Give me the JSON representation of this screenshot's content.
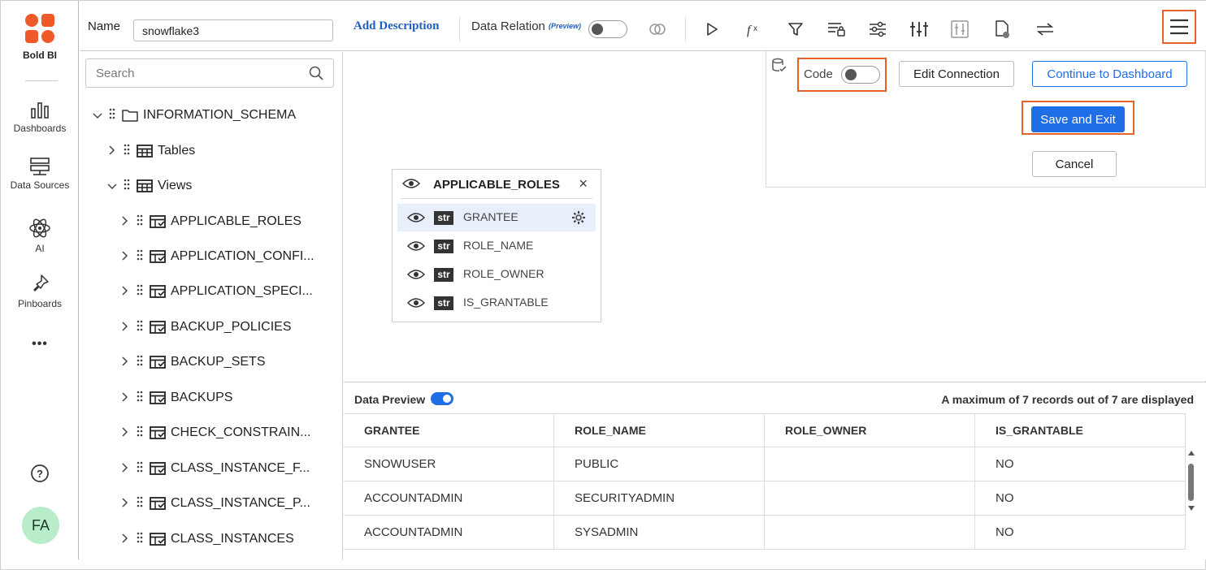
{
  "nav": {
    "brand": "Bold BI",
    "items": [
      {
        "label": "Dashboards",
        "icon": "bar-chart-icon"
      },
      {
        "label": "Data Sources",
        "icon": "server-icon"
      },
      {
        "label": "AI",
        "icon": "atom-icon"
      },
      {
        "label": "Pinboards",
        "icon": "pin-icon"
      }
    ],
    "more": "•••",
    "help": "?",
    "avatar": "FA"
  },
  "toolbar": {
    "name_label": "Name",
    "name_value": "snowflake3",
    "add_description": "Add Description",
    "data_relation": "Data Relation",
    "preview_tag": "(Preview)",
    "icons": [
      "join-icon",
      "run-icon",
      "expression-icon",
      "filter-icon",
      "parameter-icon",
      "settings-sliders-icon",
      "columns-adjust-icon",
      "column-setting-icon",
      "data-status-icon",
      "swap-icon",
      "hamburger-menu-icon"
    ]
  },
  "left_panel": {
    "search_placeholder": "Search",
    "schema": "INFORMATION_SCHEMA",
    "tables_folder": "Tables",
    "views_folder": "Views",
    "views": [
      "APPLICABLE_ROLES",
      "APPLICATION_CONFI...",
      "APPLICATION_SPECI...",
      "BACKUP_POLICIES",
      "BACKUP_SETS",
      "BACKUPS",
      "CHECK_CONSTRAIN...",
      "CLASS_INSTANCE_F...",
      "CLASS_INSTANCE_P...",
      "CLASS_INSTANCES"
    ]
  },
  "connection": {
    "code_label": "Code",
    "edit_connection": "Edit Connection",
    "continue": "Continue to Dashboard",
    "save_exit": "Save and Exit",
    "cancel": "Cancel"
  },
  "card": {
    "title": "APPLICABLE_ROLES",
    "close": "×",
    "type_badge": "str",
    "columns": [
      "GRANTEE",
      "ROLE_NAME",
      "ROLE_OWNER",
      "IS_GRANTABLE"
    ]
  },
  "preview": {
    "label": "Data Preview",
    "enabled": true,
    "info": "A maximum of 7 records out of 7 are displayed",
    "headers": [
      "GRANTEE",
      "ROLE_NAME",
      "ROLE_OWNER",
      "IS_GRANTABLE"
    ],
    "rows": [
      [
        "SNOWUSER",
        "PUBLIC",
        "",
        "NO"
      ],
      [
        "ACCOUNTADMIN",
        "SECURITYADMIN",
        "",
        "NO"
      ],
      [
        "ACCOUNTADMIN",
        "SYSADMIN",
        "",
        "NO"
      ]
    ]
  },
  "colors": {
    "accent": "#1f6ee8",
    "highlight": "#e8632c",
    "brand": "#f05a28"
  }
}
